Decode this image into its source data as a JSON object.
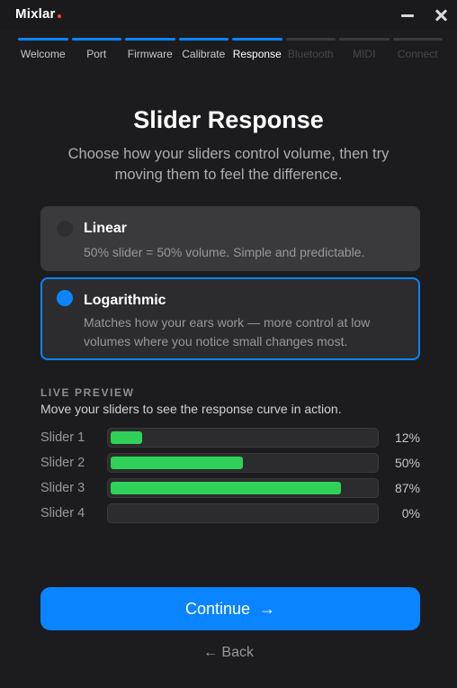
{
  "app": {
    "name": "Mixlar",
    "accent_dot_color": "#ff453a"
  },
  "window_controls": {
    "minimize_icon": "minimize-icon",
    "close_icon": "close-icon"
  },
  "steps": [
    {
      "label": "Welcome",
      "state": "done"
    },
    {
      "label": "Port",
      "state": "done"
    },
    {
      "label": "Firmware",
      "state": "done"
    },
    {
      "label": "Calibrate",
      "state": "done"
    },
    {
      "label": "Response",
      "state": "current"
    },
    {
      "label": "Bluetooth",
      "state": "pending"
    },
    {
      "label": "MIDI",
      "state": "pending"
    },
    {
      "label": "Connect",
      "state": "pending"
    }
  ],
  "heading": {
    "title": "Slider Response",
    "subtitle": "Choose how your sliders control volume, then try moving them to feel the difference."
  },
  "options": {
    "linear": {
      "title": "Linear",
      "description": "50% slider = 50% volume. Simple and predictable.",
      "selected": false
    },
    "logarithmic": {
      "title": "Logarithmic",
      "description": "Matches how your ears work — more control at low volumes where you notice small changes most.",
      "selected": true
    }
  },
  "preview": {
    "label": "LIVE PREVIEW",
    "description": "Move your sliders to see the response curve in action.",
    "sliders": [
      {
        "name": "Slider 1",
        "percent_label": "12%",
        "value": 12
      },
      {
        "name": "Slider 2",
        "percent_label": "50%",
        "value": 50
      },
      {
        "name": "Slider 3",
        "percent_label": "87%",
        "value": 87
      },
      {
        "name": "Slider 4",
        "percent_label": "0%",
        "value": 0
      }
    ]
  },
  "actions": {
    "continue_label": "Continue",
    "continue_arrow": "→",
    "back_label": "← Back"
  },
  "colors": {
    "accent": "#0a84ff",
    "fill": "#30d158",
    "background": "#1c1c1e"
  }
}
